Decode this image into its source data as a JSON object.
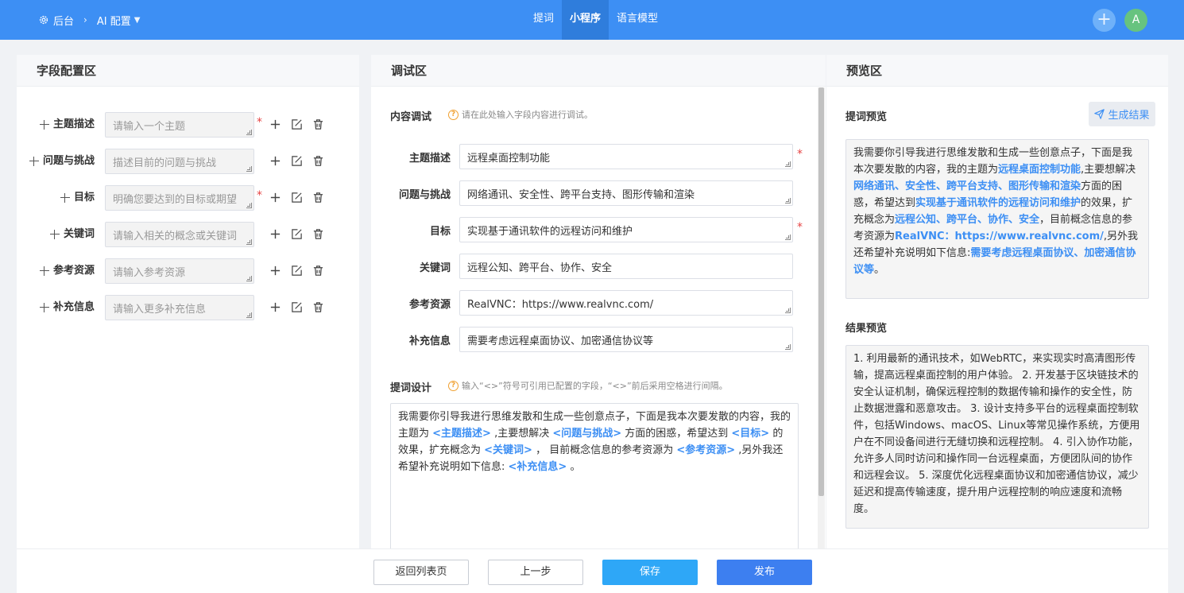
{
  "header": {
    "breadcrumb_root": "后台",
    "breadcrumb_current": "AI 配置",
    "tabs": [
      {
        "label": "提词"
      },
      {
        "label": "小程序"
      },
      {
        "label": "语言模型"
      }
    ],
    "avatar_letter": "A",
    "plus_symbol": "+"
  },
  "field_config": {
    "title": "字段配置区",
    "fields": [
      {
        "label": "主题描述",
        "placeholder": "请输入一个主题",
        "required": true
      },
      {
        "label": "问题与挑战",
        "placeholder": "描述目前的问题与挑战",
        "required": false
      },
      {
        "label": "目标",
        "placeholder": "明确您要达到的目标或期望",
        "required": true
      },
      {
        "label": "关键词",
        "placeholder": "请输入相关的概念或关键词",
        "required": false
      },
      {
        "label": "参考资源",
        "placeholder": "请输入参考资源",
        "required": false
      },
      {
        "label": "补充信息",
        "placeholder": "请输入更多补充信息",
        "required": false
      }
    ],
    "required_mark": "*"
  },
  "debug": {
    "title": "调试区",
    "content_debug_title": "内容调试",
    "content_debug_hint": "请在此处输入字段内容进行调试。",
    "rows": [
      {
        "label": "主题描述",
        "value": "远程桌面控制功能"
      },
      {
        "label": "问题与挑战",
        "value": "网络通讯、安全性、跨平台支持、图形传输和渲染"
      },
      {
        "label": "目标",
        "value": "实现基于通讯软件的远程访问和维护"
      },
      {
        "label": "关键词",
        "value": "远程公知、跨平台、协作、安全"
      },
      {
        "label": "参考资源",
        "value": "RealVNC：https://www.realvnc.com/"
      },
      {
        "label": "补充信息",
        "value": "需要考虑远程桌面协议、加密通信协议等"
      }
    ],
    "design_title": "提词设计",
    "design_hint": "输入“<>”符号可引用已配置的字段，“<>”前后采用空格进行间隔。",
    "design_segments": [
      {
        "t": "我需要你引导我进行思维发散和生成一些创意点子，下面是我本次要发散的内容，我的主题为 "
      },
      {
        "t": "<主题描述>",
        "tag": true
      },
      {
        "t": " ,主要想解决 "
      },
      {
        "t": "<问题与挑战>",
        "tag": true
      },
      {
        "t": " 方面的困惑，希望达到 "
      },
      {
        "t": "<目标>",
        "tag": true
      },
      {
        "t": " 的效果，扩充概念为 "
      },
      {
        "t": "<关键词>",
        "tag": true
      },
      {
        "t": " ， 目前概念信息的参考资源为 "
      },
      {
        "t": "<参考资源>",
        "tag": true
      },
      {
        "t": " ,另外我还希望补充说明如下信息: "
      },
      {
        "t": "<补充信息>",
        "tag": true
      },
      {
        "t": " 。"
      }
    ]
  },
  "preview": {
    "title": "预览区",
    "prompt_preview_title": "提词预览",
    "generate_label": "生成结果",
    "prompt_segments": [
      {
        "t": "我需要你引导我进行思维发散和生成一些创意点子，下面是我本次要发散的内容，我的主题为"
      },
      {
        "t": "远程桌面控制功能",
        "hl": true
      },
      {
        "t": ",主要想解决"
      },
      {
        "t": "网络通讯、安全性、跨平台支持、图形传输和渲染",
        "hl": true
      },
      {
        "t": "方面的困惑，希望达到"
      },
      {
        "t": "实现基于通讯软件的远程访问和维护",
        "hl": true
      },
      {
        "t": "的效果，扩充概念为"
      },
      {
        "t": "远程公知、跨平台、协作、安全",
        "hl": true
      },
      {
        "t": "，目前概念信息的参考资源为"
      },
      {
        "t": "RealVNC：https://www.realvnc.com/",
        "hl": true
      },
      {
        "t": ",另外我还希望补充说明如下信息:"
      },
      {
        "t": "需要考虑远程桌面协议、加密通信协议等",
        "hl": true
      },
      {
        "t": "。"
      }
    ],
    "result_preview_title": "结果预览",
    "result_text": "1. 利用最新的通讯技术，如WebRTC，来实现实时高清图形传输，提高远程桌面控制的用户体验。 2. 开发基于区块链技术的安全认证机制，确保远程控制的数据传输和操作的安全性，防止数据泄露和恶意攻击。 3. 设计支持多平台的远程桌面控制软件，包括Windows、macOS、Linux等常见操作系统，方便用户在不同设备间进行无缝切换和远程控制。 4. 引入协作功能，允许多人同时访问和操作同一台远程桌面，方便团队间的协作和远程会议。 5. 深度优化远程桌面协议和加密通信协议，减少延迟和提高传输速度，提升用户远程控制的响应速度和流畅度。"
  },
  "footer": {
    "back_label": "返回列表页",
    "prev_label": "上一步",
    "save_label": "保存",
    "publish_label": "发布"
  }
}
